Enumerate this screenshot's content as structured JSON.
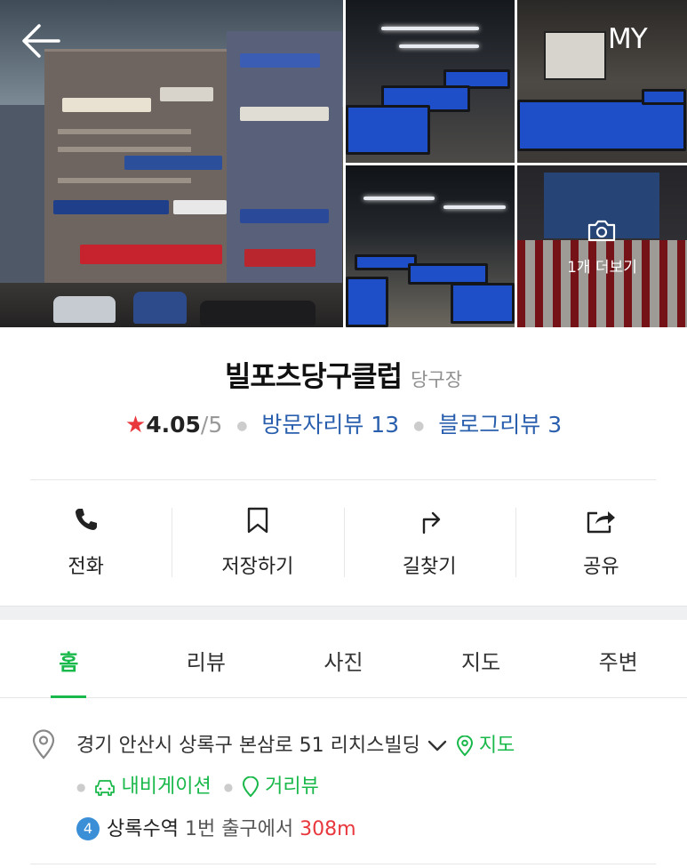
{
  "header": {
    "my_label": "MY",
    "more_photos_label": "1개 더보기"
  },
  "place": {
    "name": "빌포츠당구클럽",
    "category": "당구장",
    "rating": "4.05",
    "rating_max": "/5",
    "visitor_reviews": "방문자리뷰 13",
    "blog_reviews": "블로그리뷰 3"
  },
  "actions": [
    {
      "label": "전화",
      "icon": "phone-icon"
    },
    {
      "label": "저장하기",
      "icon": "bookmark-icon"
    },
    {
      "label": "길찾기",
      "icon": "directions-icon"
    },
    {
      "label": "공유",
      "icon": "share-icon"
    }
  ],
  "tabs": [
    {
      "label": "홈",
      "active": true
    },
    {
      "label": "리뷰",
      "active": false
    },
    {
      "label": "사진",
      "active": false
    },
    {
      "label": "지도",
      "active": false
    },
    {
      "label": "주변",
      "active": false
    }
  ],
  "address": {
    "text": "경기 안산시 상록구 본삼로 51 리치스빌딩",
    "map_link": "지도",
    "navigation_link": "내비게이션",
    "street_view_link": "거리뷰"
  },
  "transit": {
    "line_number": "4",
    "station": "상록수역",
    "exit_text": " 1번 출구에서 ",
    "distance": "308m"
  },
  "colors": {
    "accent_green": "#19b84a",
    "link_blue": "#2a5fae",
    "star_red": "#e8383d",
    "line4_blue": "#3a8fd6"
  }
}
